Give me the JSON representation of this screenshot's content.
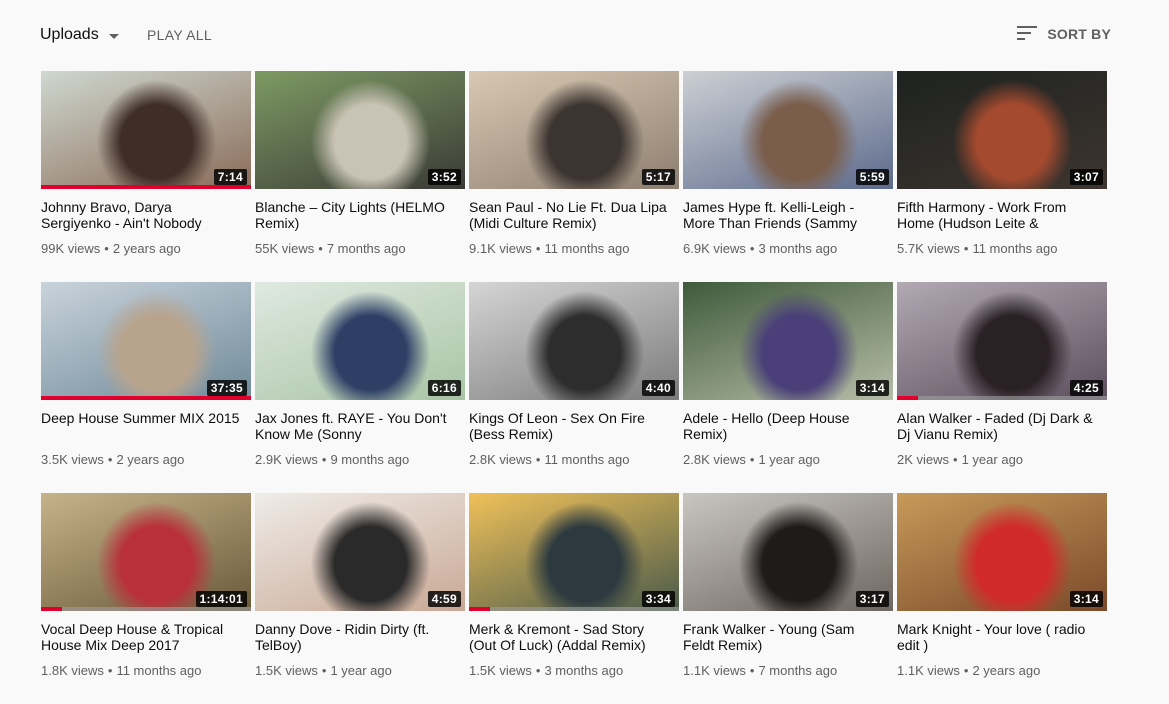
{
  "header": {
    "uploads_label": "Uploads",
    "play_all_label": "PLAY ALL",
    "sort_by_label": "SORT BY"
  },
  "videos": [
    {
      "title": "Johnny Bravo, Darya Sergiyenko - Ain't Nobody",
      "duration": "7:14",
      "views": "99K views",
      "age": "2 years ago",
      "watched": 1.0,
      "thumb_colors": [
        "#cfd8d0",
        "#8a6b58",
        "#3f2e28"
      ]
    },
    {
      "title": "Blanche – City Lights (HELMO Remix)",
      "duration": "3:52",
      "views": "55K views",
      "age": "7 months ago",
      "watched": 0,
      "thumb_colors": [
        "#7d9a63",
        "#3a3a36",
        "#c9c3b5"
      ]
    },
    {
      "title": "Sean Paul - No Lie Ft. Dua Lipa (Midi Culture Remix)",
      "duration": "5:17",
      "views": "9.1K views",
      "age": "11 months ago",
      "watched": 0,
      "thumb_colors": [
        "#d9c9b3",
        "#8d7e70",
        "#3b3430"
      ]
    },
    {
      "title": "James Hype ft. Kelli-Leigh - More Than Friends (Sammy",
      "duration": "5:59",
      "views": "6.9K views",
      "age": "3 months ago",
      "watched": 0,
      "thumb_colors": [
        "#cdd0d4",
        "#5c6a8c",
        "#7a5d4a"
      ]
    },
    {
      "title": "Fifth Harmony - Work From Home (Hudson Leite &",
      "duration": "3:07",
      "views": "5.7K views",
      "age": "11 months ago",
      "watched": 0,
      "thumb_colors": [
        "#1e221f",
        "#3d3530",
        "#a44a2e"
      ]
    },
    {
      "title": "Deep House Summer MIX 2015",
      "duration": "37:35",
      "views": "3.5K views",
      "age": "2 years ago",
      "watched": 1.0,
      "thumb_colors": [
        "#c9d3dc",
        "#6f8a99",
        "#b8a48d"
      ]
    },
    {
      "title": "Jax Jones ft. RAYE - You Don't Know Me (Sonny",
      "duration": "6:16",
      "views": "2.9K views",
      "age": "9 months ago",
      "watched": 0,
      "thumb_colors": [
        "#dfe9e1",
        "#a8c4a4",
        "#2e3f66"
      ]
    },
    {
      "title": "Kings Of Leon - Sex On Fire (Bess Remix)",
      "duration": "4:40",
      "views": "2.8K views",
      "age": "11 months ago",
      "watched": 0,
      "thumb_colors": [
        "#d5d5d5",
        "#7b7b7b",
        "#2d2d2d"
      ]
    },
    {
      "title": "Adele - Hello (Deep House Remix)",
      "duration": "3:14",
      "views": "2.8K views",
      "age": "1 year ago",
      "watched": 0,
      "thumb_colors": [
        "#3f5a3b",
        "#b7bda8",
        "#4a3f78"
      ]
    },
    {
      "title": "Alan Walker - Faded (Dj Dark & Dj Vianu Remix)",
      "duration": "4:25",
      "views": "2K views",
      "age": "1 year ago",
      "watched": 0.1,
      "thumb_colors": [
        "#b2a9b3",
        "#5d4f5e",
        "#2a2125"
      ]
    },
    {
      "title": "Vocal Deep House & Tropical House Mix Deep 2017",
      "duration": "1:14:01",
      "views": "1.8K views",
      "age": "11 months ago",
      "watched": 0.1,
      "thumb_colors": [
        "#c7b38a",
        "#6a5a3a",
        "#b9303a"
      ]
    },
    {
      "title": "Danny Dove - Ridin Dirty (ft. TelBoy)",
      "duration": "4:59",
      "views": "1.5K views",
      "age": "1 year ago",
      "watched": 0,
      "thumb_colors": [
        "#efece8",
        "#c9a895",
        "#2a2a2a"
      ]
    },
    {
      "title": "Merk & Kremont - Sad Story (Out Of Luck) (Addal Remix)",
      "duration": "3:34",
      "views": "1.5K views",
      "age": "3 months ago",
      "watched": 0.1,
      "thumb_colors": [
        "#f0c15a",
        "#4a5a4a",
        "#2c3a3f"
      ]
    },
    {
      "title": "Frank Walker - Young (Sam Feldt Remix)",
      "duration": "3:17",
      "views": "1.1K views",
      "age": "7 months ago",
      "watched": 0,
      "thumb_colors": [
        "#c9c6c1",
        "#6d6661",
        "#1e1b1a"
      ]
    },
    {
      "title": "Mark Knight - Your love ( radio edit )",
      "duration": "3:14",
      "views": "1.1K views",
      "age": "2 years ago",
      "watched": 0,
      "thumb_colors": [
        "#c79a5a",
        "#7a4a2a",
        "#d12a2a"
      ]
    }
  ],
  "colors": {
    "background": "#f9f9f9",
    "progress": "#e1002d",
    "secondary_text": "#606060"
  }
}
